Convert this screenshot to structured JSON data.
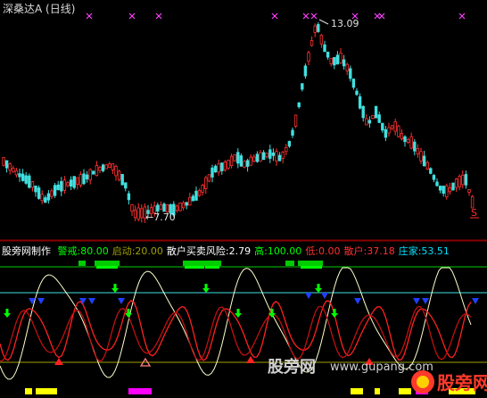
{
  "app": {
    "title": "深桑达A (日线)"
  },
  "price_annotations": {
    "high_label": "13.09",
    "low_label": "←7.70",
    "marker_label": "S"
  },
  "indicator": {
    "name": "股旁网制作",
    "params": [
      {
        "label": "警戒:",
        "value": "80.00",
        "color": "#00ff00"
      },
      {
        "label": "启动:",
        "value": "20.00",
        "color": "#a0a000"
      },
      {
        "label": "散户买卖风险:",
        "value": "2.79",
        "color": "#ffffff"
      },
      {
        "label": "高:",
        "value": "100.00",
        "color": "#00ff00"
      },
      {
        "label": "低:",
        "value": "0.00",
        "color": "#ff3030"
      },
      {
        "label": "散户:",
        "value": "37.18",
        "color": "#ff3030"
      },
      {
        "label": "庄家:",
        "value": "53.51",
        "color": "#00e0ff"
      }
    ]
  },
  "watermark": {
    "site_cn": "股旁网",
    "site_url": "www.gupang.com",
    "logo_text": "股旁网"
  },
  "colors": {
    "background": "#000000",
    "candle_up": "#ff3030",
    "candle_down": "#40e0e0",
    "grid_line": "#c0c0c0",
    "cross_marker": "#ff40ff",
    "white_line": "#ffffcc",
    "red_line": "#ff2020",
    "green_bar": "#00cc00",
    "blue_arrow": "#2040ff",
    "green_arrow": "#00ff00",
    "red_arrow": "#ff2020",
    "yellow_block": "#ffff00",
    "magenta_block": "#ff00ff"
  },
  "chart_data": {
    "type": "candlestick",
    "y_high_label": 13.09,
    "y_low_label": 7.7
  }
}
